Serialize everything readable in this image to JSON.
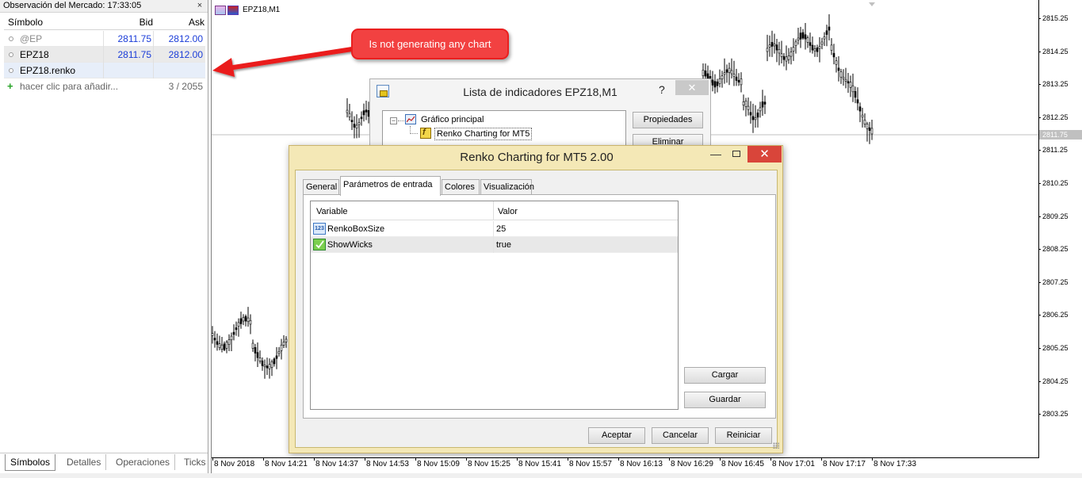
{
  "market_watch": {
    "title": "Observación del Mercado: 17:33:05",
    "close_glyph": "×",
    "columns": {
      "symbol": "Símbolo",
      "bid": "Bid",
      "ask": "Ask"
    },
    "rows": [
      {
        "symbol": "@EP",
        "bid": "2811.75",
        "ask": "2812.00"
      },
      {
        "symbol": "EPZ18",
        "bid": "2811.75",
        "ask": "2812.00"
      },
      {
        "symbol": "EPZ18.renko",
        "bid": "",
        "ask": ""
      }
    ],
    "add_symbol": {
      "plus": "+",
      "label": "hacer clic para añadir...",
      "count": "3 / 2055"
    },
    "tabs": [
      "Símbolos",
      "Detalles",
      "Operaciones",
      "Ticks"
    ]
  },
  "chart": {
    "title": "EPZ18,M1",
    "current_price": "2811.75",
    "price_ticks": [
      "2815.25",
      "2814.25",
      "2813.25",
      "2812.25",
      "2811.25",
      "2810.25",
      "2809.25",
      "2808.25",
      "2807.25",
      "2806.25",
      "2805.25",
      "2804.25",
      "2803.25"
    ],
    "time_ticks": [
      "8 Nov 2018",
      "8 Nov 14:21",
      "8 Nov 14:37",
      "8 Nov 14:53",
      "8 Nov 15:09",
      "8 Nov 15:25",
      "8 Nov 15:41",
      "8 Nov 15:57",
      "8 Nov 16:13",
      "8 Nov 16:29",
      "8 Nov 16:45",
      "8 Nov 17:01",
      "8 Nov 17:17",
      "8 Nov 17:33"
    ]
  },
  "annotation": {
    "text": "Is not generating any chart",
    "color": "#f24141"
  },
  "indicator_list": {
    "title": "Lista de indicadores EPZ18,M1",
    "help_glyph": "?",
    "close_glyph": "✕",
    "tree": {
      "expander": "−",
      "main": "Gráfico principal",
      "child": "Renko Charting for MT5"
    },
    "buttons": {
      "properties": "Propiedades",
      "delete": "Eliminar"
    }
  },
  "renko_dialog": {
    "title": "Renko Charting for MT5 2.00",
    "min_glyph": "—",
    "close_glyph": "✕",
    "background": "#f4e8b6",
    "tabs": [
      "General",
      "Parámetros de entrada",
      "Colores",
      "Visualización"
    ],
    "active_tab": "Parámetros de entrada",
    "grid": {
      "headers": {
        "variable": "Variable",
        "value": "Valor"
      },
      "rows": [
        {
          "icon": "numeric-icon",
          "icon_text": "123",
          "name": "RenkoBoxSize",
          "value": "25"
        },
        {
          "icon": "boolean-icon",
          "icon_text": "",
          "name": "ShowWicks",
          "value": "true"
        }
      ]
    },
    "side_buttons": {
      "load": "Cargar",
      "save": "Guardar"
    },
    "footer_buttons": {
      "ok": "Aceptar",
      "cancel": "Cancelar",
      "reset": "Reiniciar"
    }
  }
}
